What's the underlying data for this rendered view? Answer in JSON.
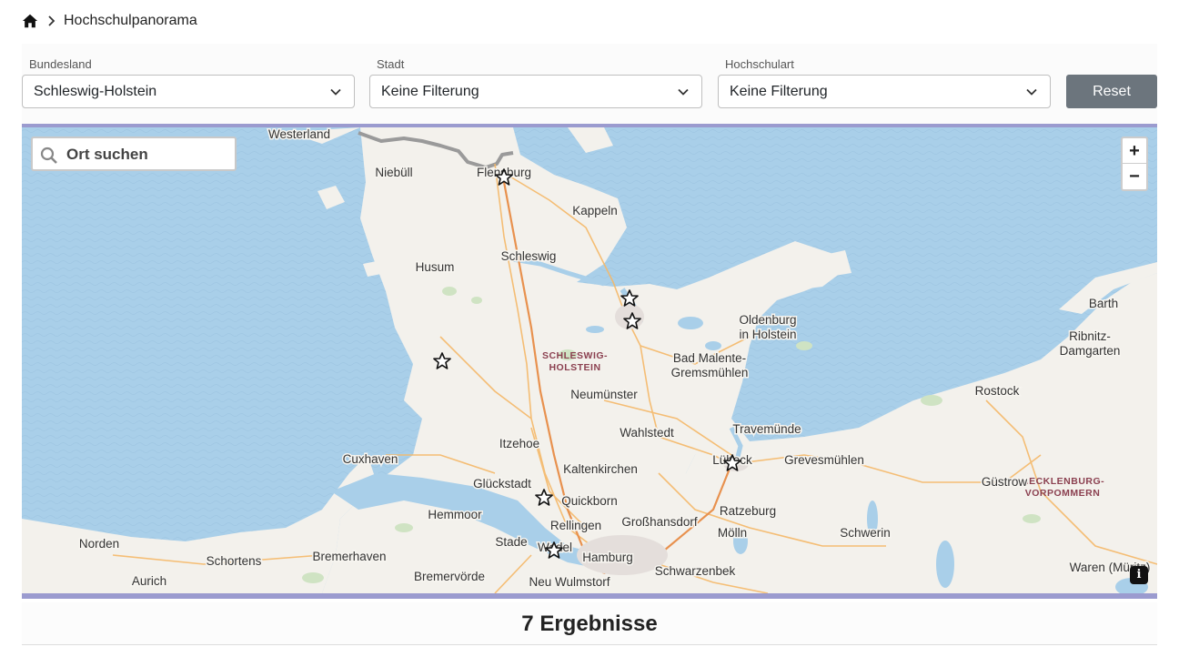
{
  "breadcrumb": {
    "home_icon": "home-icon",
    "current": "Hochschulpanorama"
  },
  "filters": {
    "bundesland": {
      "label": "Bundesland",
      "value": "Schleswig-Holstein"
    },
    "stadt": {
      "label": "Stadt",
      "value": "Keine Filterung"
    },
    "hochschulart": {
      "label": "Hochschulart",
      "value": "Keine Filterung"
    },
    "reset_label": "Reset"
  },
  "map": {
    "search_placeholder": "Ort suchen",
    "zoom_in": "+",
    "zoom_out": "−",
    "info": "i",
    "region_labels": [
      "SCHLESWIG-HOLSTEIN",
      "MECKLENBURG-VORPOMMERN"
    ],
    "places": [
      "Westerland",
      "Niebüll",
      "Flensburg",
      "Kappeln",
      "Schleswig",
      "Husum",
      "Oldenburg in Holstein",
      "Bad Malente-Gremsmühlen",
      "Neumünster",
      "Wahlstedt",
      "Itzehoe",
      "Travemünde",
      "Lübeck",
      "Grevesmühlen",
      "Cuxhaven",
      "Glückstadt",
      "Kaltenkirchen",
      "Quickborn",
      "Hemmoor",
      "Rellingen",
      "Großhansdorf",
      "Ratzeburg",
      "Stade",
      "Wedel",
      "Hamburg",
      "Schwarzenbek",
      "Norden",
      "Schortens",
      "Bremerhaven",
      "Bremervörde",
      "Neu Wulmstorf",
      "Aurich",
      "Barth",
      "Ribnitz-Damgarten",
      "Rostock",
      "Güstrow",
      "Schwerin",
      "Waren (Müritz)",
      "Mölln"
    ],
    "markers": 7,
    "colors": {
      "water": "#a9cfe9",
      "land": "#f3f1ec",
      "road": "#f5b868",
      "border": "#9a9a9a"
    }
  },
  "results": {
    "count_label": "7 Ergebnisse"
  }
}
